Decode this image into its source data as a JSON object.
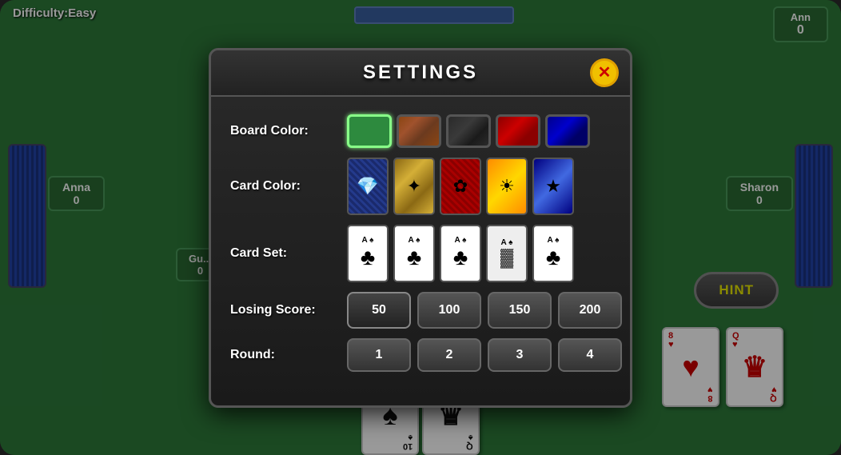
{
  "game": {
    "difficulty_label": "Difficulty:Easy",
    "players": {
      "ann": {
        "name": "Ann",
        "score": "0"
      },
      "anna": {
        "name": "Anna",
        "score": "0"
      },
      "guest": {
        "name": "Gu...",
        "score": "0"
      },
      "sharon": {
        "name": "Sharon",
        "score": "0"
      }
    },
    "hint_label": "HINT"
  },
  "settings": {
    "title": "SETTINGS",
    "close_icon": "✕",
    "board_color_label": "Board Color:",
    "card_color_label": "Card Color:",
    "card_set_label": "Card Set:",
    "losing_score_label": "Losing Score:",
    "round_label": "Round:",
    "board_colors": [
      {
        "id": "green",
        "selected": true
      },
      {
        "id": "wood",
        "selected": false
      },
      {
        "id": "dark",
        "selected": false
      },
      {
        "id": "red",
        "selected": false
      },
      {
        "id": "blue",
        "selected": false
      }
    ],
    "card_colors": [
      {
        "id": "cb-blue",
        "selected": false
      },
      {
        "id": "cb-gold",
        "selected": false
      },
      {
        "id": "cb-red",
        "selected": false
      },
      {
        "id": "cb-orange",
        "selected": false
      },
      {
        "id": "cb-navy",
        "selected": false
      }
    ],
    "card_sets": [
      {
        "suit": "♣",
        "label": "A",
        "selected": false
      },
      {
        "suit": "♣",
        "label": "A",
        "selected": false
      },
      {
        "suit": "♣",
        "label": "A",
        "selected": false
      },
      {
        "suit": "♣",
        "label": "A",
        "selected": false
      },
      {
        "suit": "♣",
        "label": "A",
        "selected": false
      }
    ],
    "losing_scores": [
      {
        "value": "50",
        "selected": false
      },
      {
        "value": "100",
        "selected": false
      },
      {
        "value": "150",
        "selected": false
      },
      {
        "value": "200",
        "selected": false
      }
    ],
    "rounds": [
      {
        "value": "1",
        "selected": false
      },
      {
        "value": "2",
        "selected": false
      },
      {
        "value": "3",
        "selected": false
      },
      {
        "value": "4",
        "selected": false
      }
    ]
  },
  "bottom_cards": [
    {
      "rank": "10",
      "suit": "♠",
      "type": "spade"
    },
    {
      "rank": "Q",
      "suit": "♠",
      "type": "spade"
    }
  ],
  "right_cards": [
    {
      "rank": "8",
      "suit": "♥",
      "type": "heart"
    },
    {
      "rank": "Q",
      "suit": "♥",
      "type": "heart"
    }
  ]
}
